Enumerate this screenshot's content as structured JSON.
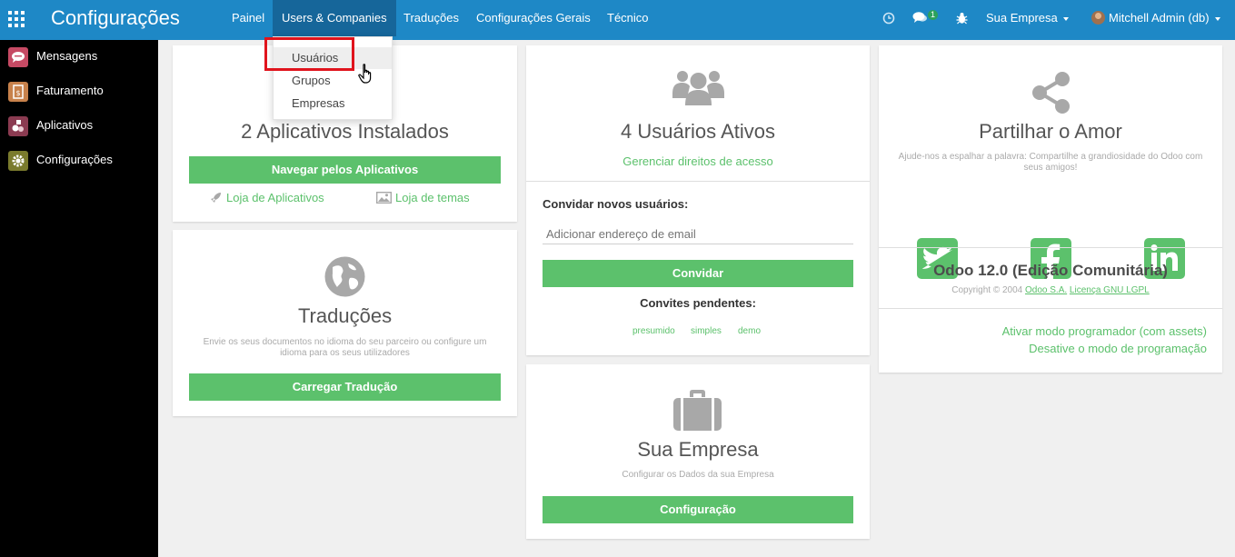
{
  "topbar": {
    "app_title": "Configurações",
    "menu": [
      "Painel",
      "Users & Companies",
      "Traduções",
      "Configurações Gerais",
      "Técnico"
    ],
    "chat_badge": "1",
    "company": "Sua Empresa",
    "user": "Mitchell Admin (db)"
  },
  "dropdown": {
    "items": [
      "Usuários",
      "Grupos",
      "Empresas"
    ]
  },
  "sidebar": {
    "items": [
      {
        "label": "Mensagens",
        "color": "#c64a64"
      },
      {
        "label": "Faturamento",
        "color": "#c7814b"
      },
      {
        "label": "Aplicativos",
        "color": "#8b3b51"
      },
      {
        "label": "Configurações",
        "color": "#7a7b2d"
      }
    ]
  },
  "apps_card": {
    "title": "2 Aplicativos Instalados",
    "button": "Navegar pelos Aplicativos",
    "link_apps": "Loja de Aplicativos",
    "link_themes": "Loja de temas"
  },
  "translations_card": {
    "title": "Traduções",
    "description": "Envie os seus documentos no idioma do seu parceiro ou configure um idioma para os seus utilizadores",
    "button": "Carregar Tradução"
  },
  "users_card": {
    "title": "4 Usuários Ativos",
    "manage_link": "Gerenciar direitos de acesso",
    "invite_label": "Convidar novos usuários:",
    "email_placeholder": "Adicionar endereço de email",
    "invite_button": "Convidar",
    "pending_label": "Convites pendentes:",
    "pending": [
      "presumido",
      "simples",
      "demo"
    ]
  },
  "company_card": {
    "title": "Sua Empresa",
    "description": "Configurar os Dados da sua Empresa",
    "button": "Configuração"
  },
  "share_card": {
    "title": "Partilhar o Amor",
    "description": "Ajude-nos a espalhar a palavra: Compartilhe a grandiosidade do Odoo com seus amigos!",
    "version": "Odoo 12.0 (Edição Comunitária)",
    "copyright": "Copyright © 2004",
    "odoo_link": "Odoo S.A.",
    "license_link": "Licença GNU LGPL",
    "dev_mode_assets": "Ativar modo programador (com assets)",
    "dev_mode_off": "Desative o modo de programação"
  },
  "colors": {
    "topbar": "#1e88c6",
    "accent_green": "#5cc16c",
    "highlight_red": "#e0141d"
  }
}
